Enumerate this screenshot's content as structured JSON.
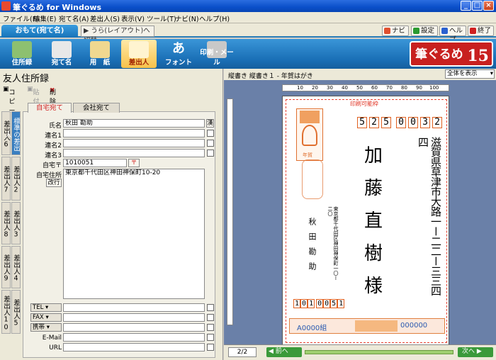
{
  "window": {
    "title": "筆ぐるめ for Windows"
  },
  "menu": [
    "ファイル(F)",
    "編集(E)",
    "宛て名(A)",
    "差出人(S)",
    "表示(V)",
    "ツール(T)",
    "ナビ(N)",
    "ヘルプ(H)"
  ],
  "tabs": {
    "front": "おもて(宛て名)",
    "back": "うら(レイアウト)へ切替"
  },
  "top_buttons": {
    "navi": "ナビ",
    "settings": "設定",
    "help": "ヘルプ",
    "exit": "終了"
  },
  "toolbar": [
    "住所録",
    "宛て名",
    "用　紙",
    "差出人",
    "フォント",
    "印刷・メール"
  ],
  "logo": {
    "text": "筆ぐるめ",
    "version": "15",
    "ver_label": "Ver."
  },
  "left": {
    "title": "友人住所録",
    "tools": {
      "copy": "コピー",
      "paste": "貼付",
      "delete": "削除"
    },
    "side_tabs_left": [
      "差出人6",
      "差出人7",
      "差出人8",
      "差出人9",
      "差出人10"
    ],
    "side_tabs_right": [
      "標準の差出人",
      "差出人2",
      "差出人3",
      "差出人4",
      "差出人5"
    ],
    "form_tabs": {
      "home": "自宅宛て",
      "office": "会社宛て"
    },
    "fields": {
      "name_label": "氏名",
      "name_value": "秋田 勘助",
      "name_btn": "漢",
      "renmei1": "連名1",
      "renmei2": "連名2",
      "renmei3": "連名3",
      "zip_label": "自宅〒",
      "zip_value": "1010051",
      "zip_btn": "〒",
      "addr_label": "自宅住所",
      "addr_value": "東京都千代田区神田神保町10-20",
      "kaigyo": "改行",
      "tel": "TEL",
      "fax": "FAX",
      "mobile": "携帯",
      "email": "E-Mail",
      "url": "URL"
    }
  },
  "right": {
    "caption": "縦書き 縦書き１ - 年賀はがき",
    "view_select": "全体を表示",
    "ruler_labels": [
      "10",
      "20",
      "30",
      "40",
      "50",
      "60",
      "70",
      "80",
      "90",
      "100"
    ],
    "printable": "印刷可能枠",
    "dest_zip": [
      "5",
      "2",
      "5",
      "0",
      "0",
      "3",
      "2"
    ],
    "dest_address": "滋賀県草津市大路一ー二二ー三三四四",
    "dest_name": [
      "加",
      "藤",
      "直",
      "樹",
      "様"
    ],
    "sender_address": "東京都千代田区神田神保町一〇ー二〇",
    "sender_name": "秋田勘助",
    "sender_zip": [
      "1",
      "0",
      "1",
      "0",
      "0",
      "5",
      "1"
    ],
    "stamp_text": "年賀",
    "lottery_left": "A0000組",
    "lottery_right": "000000",
    "page": "2/2",
    "prev": "前へ",
    "next": "次へ"
  }
}
